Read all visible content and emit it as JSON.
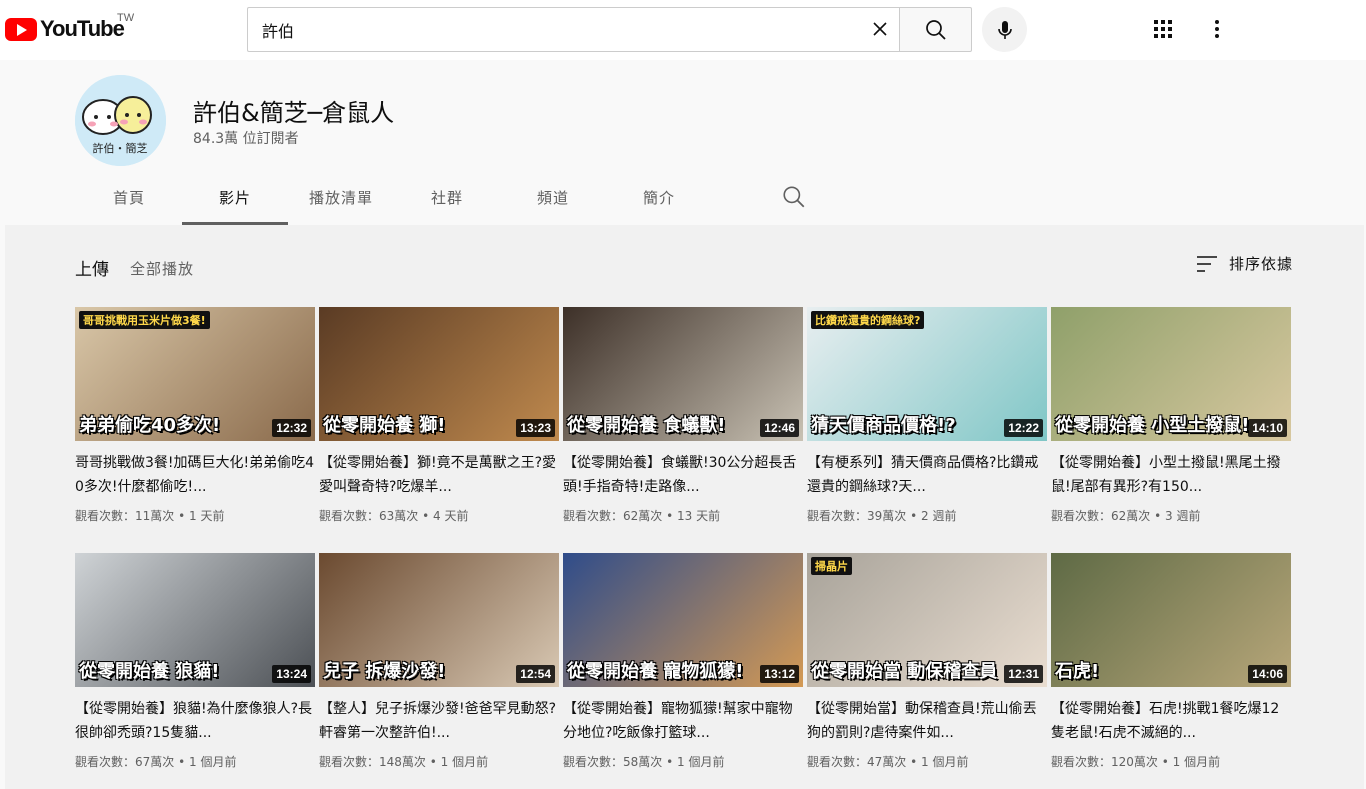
{
  "header": {
    "logo_text": "YouTube",
    "region": "TW",
    "search_value": "許伯",
    "search_placeholder": "搜尋"
  },
  "channel": {
    "name": "許伯&簡芝─倉鼠人",
    "subscribers": "84.3萬 位訂閱者",
    "avatar_text": "許伯・簡芝",
    "tabs": [
      {
        "label": "首頁"
      },
      {
        "label": "影片"
      },
      {
        "label": "播放清單"
      },
      {
        "label": "社群"
      },
      {
        "label": "頻道"
      },
      {
        "label": "簡介"
      }
    ],
    "active_tab": "影片"
  },
  "content": {
    "section_label": "上傳",
    "play_all": "全部播放",
    "sort_label": "排序依據"
  },
  "videos": [
    {
      "title": "哥哥挑戰做3餐!加碼巨大化!弟弟偷吃40多次!什麼都偷吃!...",
      "views": "觀看次數：11萬次",
      "age": "1 天前",
      "duration": "12:32",
      "thumb_caption": "弟弟偷吃40多次!",
      "thumb_tag": "哥哥挑戰用玉米片做3餐!",
      "colors": [
        "#d9c7a8",
        "#8a6a4b"
      ]
    },
    {
      "title": "【從零開始養】獅!竟不是萬獸之王?愛愛叫聲奇特?吃爆羊...",
      "views": "觀看次數：63萬次",
      "age": "4 天前",
      "duration": "13:23",
      "thumb_caption": "從零開始養 獅!",
      "thumb_tag": "",
      "colors": [
        "#5a3b24",
        "#c08a4e"
      ]
    },
    {
      "title": "【從零開始養】食蟻獸!30公分超長舌頭!手指奇特!走路像...",
      "views": "觀看次數：62萬次",
      "age": "13 天前",
      "duration": "12:46",
      "thumb_caption": "從零開始養 食蟻獸!",
      "thumb_tag": "",
      "colors": [
        "#3d3028",
        "#c9c2b4"
      ]
    },
    {
      "title": "【有梗系列】猜天價商品價格?比鑽戒還貴的鋼絲球?天...",
      "views": "觀看次數：39萬次",
      "age": "2 週前",
      "duration": "12:22",
      "thumb_caption": "猜天價商品價格!?",
      "thumb_tag": "比鑽戒還貴的鋼絲球?",
      "colors": [
        "#e8eef0",
        "#7fc6c6"
      ]
    },
    {
      "title": "【從零開始養】小型土撥鼠!黑尾土撥鼠!尾部有異形?有150...",
      "views": "觀看次數：62萬次",
      "age": "3 週前",
      "duration": "14:10",
      "thumb_caption": "從零開始養 小型土撥鼠!",
      "thumb_tag": "",
      "colors": [
        "#8fa06a",
        "#d8c8a0"
      ]
    },
    {
      "title": "【從零開始養】狼貓!為什麼像狼人?長很帥卻禿頭?15隻貓...",
      "views": "觀看次數：67萬次",
      "age": "1 個月前",
      "duration": "13:24",
      "thumb_caption": "從零開始養 狼貓!",
      "thumb_tag": "",
      "colors": [
        "#cfd3d6",
        "#4c5055"
      ]
    },
    {
      "title": "【整人】兒子拆爆沙發!爸爸罕見動怒?軒睿第一次整許伯!...",
      "views": "觀看次數：148萬次",
      "age": "1 個月前",
      "duration": "12:54",
      "thumb_caption": "兒子 拆爆沙發!",
      "thumb_tag": "",
      "colors": [
        "#6b4a30",
        "#d9c9b4"
      ]
    },
    {
      "title": "【從零開始養】寵物狐獴!幫家中寵物分地位?吃飯像打籃球...",
      "views": "觀看次數：58萬次",
      "age": "1 個月前",
      "duration": "13:12",
      "thumb_caption": "從零開始養 寵物狐獴!",
      "thumb_tag": "",
      "colors": [
        "#2f4c8a",
        "#d49a55"
      ]
    },
    {
      "title": "【從零開始當】動保稽查員!荒山偷丟狗的罰則?虐待案件如...",
      "views": "觀看次數：47萬次",
      "age": "1 個月前",
      "duration": "12:31",
      "thumb_caption": "從零開始當 動保稽查員",
      "thumb_tag": "掃晶片",
      "colors": [
        "#a8a39a",
        "#e9ddd0"
      ]
    },
    {
      "title": "【從零開始養】石虎!挑戰1餐吃爆12隻老鼠!石虎不滅絕的...",
      "views": "觀看次數：120萬次",
      "age": "1 個月前",
      "duration": "14:06",
      "thumb_caption": "石虎!",
      "thumb_tag": "",
      "colors": [
        "#5e6a45",
        "#b8a77a"
      ]
    }
  ]
}
